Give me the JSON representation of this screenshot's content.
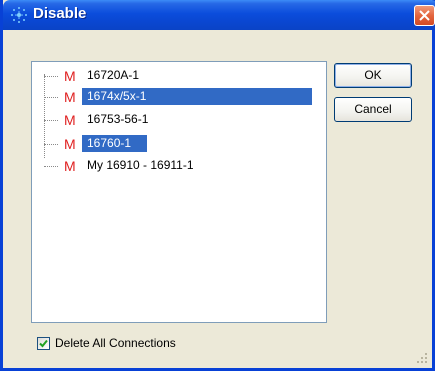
{
  "window": {
    "title": "Disable",
    "icon": "app-sparkle-icon",
    "close_icon": "close-icon"
  },
  "tree": {
    "items": [
      {
        "badge": "M",
        "label": "16720A-1",
        "selected": false
      },
      {
        "badge": "M",
        "label": "1674x/5x-1",
        "selected": true
      },
      {
        "badge": "M",
        "label": "16753-56-1",
        "selected": false
      },
      {
        "badge": "M",
        "label": "16760-1",
        "selected": true
      },
      {
        "badge": "M",
        "label": "My 16910 - 16911-1",
        "selected": false
      }
    ]
  },
  "buttons": {
    "ok_label": "OK",
    "cancel_label": "Cancel"
  },
  "options": {
    "delete_all_label": "Delete All Connections",
    "delete_all_checked": true
  },
  "colors": {
    "titlebar": "#0b4ddc",
    "selection": "#316ac5",
    "badge": "#e02020"
  }
}
